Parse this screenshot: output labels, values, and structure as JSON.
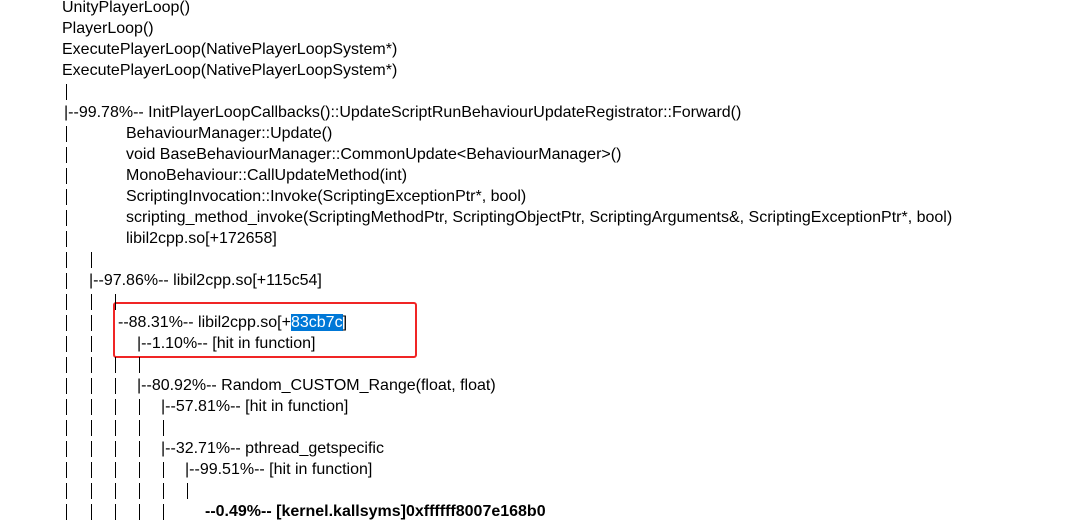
{
  "lines": {
    "l0": "UnityPlayerLoop()",
    "l1": "PlayerLoop()",
    "l2": "ExecutePlayerLoop(NativePlayerLoopSystem*)",
    "l3": "ExecutePlayerLoop(NativePlayerLoopSystem*)",
    "l5": "|--99.78%-- InitPlayerLoopCallbacks()::UpdateScriptRunBehaviourUpdateRegistrator::Forward()",
    "l6": "BehaviourManager::Update()",
    "l7": "void BaseBehaviourManager::CommonUpdate<BehaviourManager>()",
    "l8": "MonoBehaviour::CallUpdateMethod(int)",
    "l9": "ScriptingInvocation::Invoke(ScriptingExceptionPtr*, bool)",
    "l10": "scripting_method_invoke(ScriptingMethodPtr, ScriptingObjectPtr, ScriptingArguments&, ScriptingExceptionPtr*, bool)",
    "l11": "libil2cpp.so[+172658]",
    "l13": "|--97.86%-- libil2cpp.so[+115c54]",
    "l15_prefix": "--88.31%-- libil2cpp.so[+",
    "l15_selected": "83cb7c",
    "l15_suffix": "]",
    "l16": "|--1.10%-- [hit in function]",
    "l18": "|--80.92%-- Random_CUSTOM_Range(float, float)",
    "l19": "|--57.81%-- [hit in function]",
    "l21": "|--32.71%-- pthread_getspecific",
    "l22": "|--99.51%-- [hit in function]",
    "l24": "--0.49%-- [kernel.kallsyms]0xffffff8007e168b0"
  },
  "highlight_color": "#f02525",
  "selection_color": "#0078d7"
}
